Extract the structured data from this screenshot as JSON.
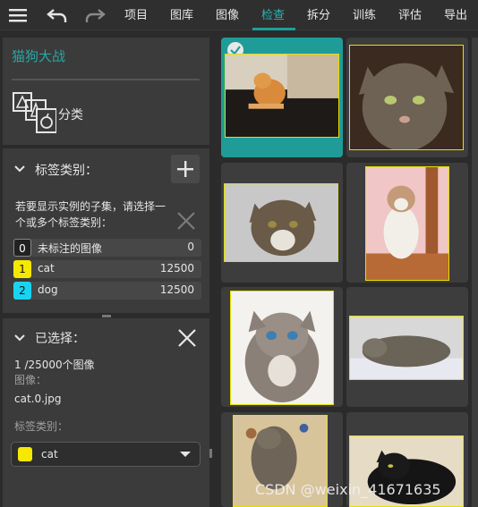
{
  "toolbar": {
    "menu_items": [
      "项目",
      "图库",
      "图像",
      "检查",
      "拆分",
      "训练",
      "评估",
      "导出"
    ],
    "active_index": 3
  },
  "project": {
    "name": "猫狗大战",
    "task_type": "分类"
  },
  "labels_section": {
    "title": "标签类别：",
    "hint": "若要显示实例的子集，请选择一个或多个标签类别：",
    "items": [
      {
        "index": "0",
        "name": "未标注的图像",
        "count": "0",
        "color": "#222222",
        "text_color": "#ffffff"
      },
      {
        "index": "1",
        "name": "cat",
        "count": "12500",
        "color": "#f7e800",
        "text_color": "#111111"
      },
      {
        "index": "2",
        "name": "dog",
        "count": "12500",
        "color": "#19d4f0",
        "text_color": "#111111"
      }
    ]
  },
  "selected_section": {
    "title": "已选择：",
    "count_text": "1 /25000个图像",
    "image_label": "图像：",
    "image_name": "cat.0.jpg",
    "label_category_label": "标签类别：",
    "label_value": "cat"
  },
  "gallery": {
    "selected_index": 0,
    "items": [
      {
        "name": "cat-photo-1"
      },
      {
        "name": "cat-photo-2"
      },
      {
        "name": "cat-photo-3"
      },
      {
        "name": "cat-photo-4"
      },
      {
        "name": "cat-photo-5"
      },
      {
        "name": "cat-photo-6"
      },
      {
        "name": "cat-photo-7"
      },
      {
        "name": "cat-photo-8"
      }
    ]
  },
  "watermark": "CSDN @weixin_41671635",
  "colors": {
    "accent": "#1e9e9a",
    "cat_label": "#f7e800",
    "dog_label": "#19d4f0"
  }
}
